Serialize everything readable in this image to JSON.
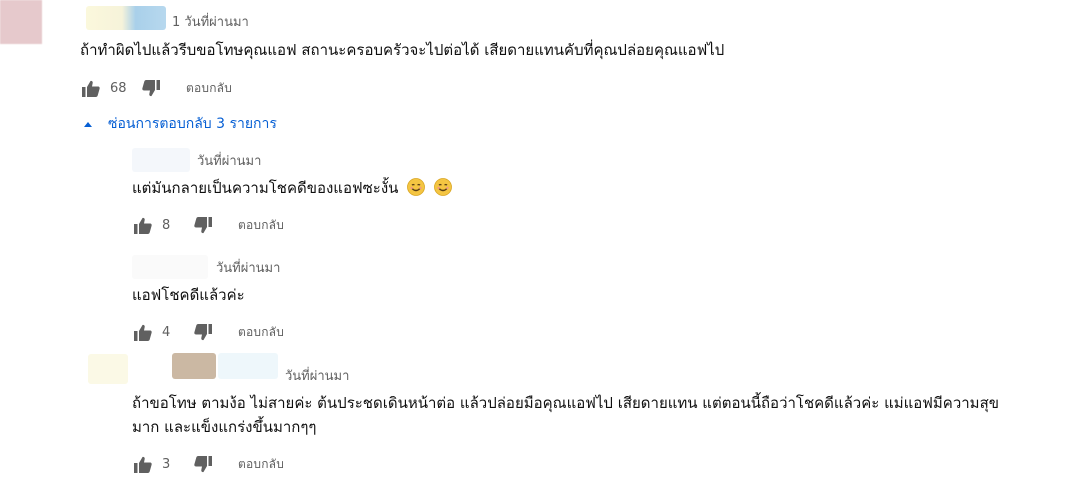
{
  "top_comment": {
    "timestamp": "1 วันที่ผ่านมา",
    "text": "ถ้าทำผิดไปแล้วรีบขอโทษคุณแอฟ สถานะครอบครัวจะไปต่อได้ เสียดายแทนคับที่คุณปล่อยคุณแอฟไป",
    "likes": "68",
    "reply_label": "ตอบกลับ"
  },
  "replies_toggle": {
    "label": "ซ่อนการตอบกลับ 3 รายการ",
    "icon": "caret-up-icon",
    "color": "#065fd4"
  },
  "replies": [
    {
      "timestamp": "วันที่ผ่านมา",
      "text": "แต่มันกลายเป็นความโชคดีของแอฟซะงั้น",
      "emoji": [
        "smiling-face-icon",
        "smiling-face-icon"
      ],
      "likes": "8",
      "reply_label": "ตอบกลับ"
    },
    {
      "timestamp": "วันที่ผ่านมา",
      "text": "แอฟโชคดีแล้วค่ะ",
      "likes": "4",
      "reply_label": "ตอบกลับ"
    },
    {
      "timestamp": "วันที่ผ่านมา",
      "text_line1": "ถ้าขอโทษ ตามง้อ ไม่สายค่ะ ต้นประชดเดินหน้าต่อ แล้วปล่อยมือคุณแอฟไป เสียดายแทน แต่ตอนนี้ถือว่าโชคดีแล้วค่ะ แม่แอฟมีความสุข",
      "text_line2": "มาก และแข็งแกร่งขึ้นมากๆๆ",
      "likes": "3",
      "reply_label": "ตอบกลับ"
    }
  ],
  "colors": {
    "text": "#0f0f0f",
    "meta": "#606060",
    "link": "#065fd4"
  }
}
